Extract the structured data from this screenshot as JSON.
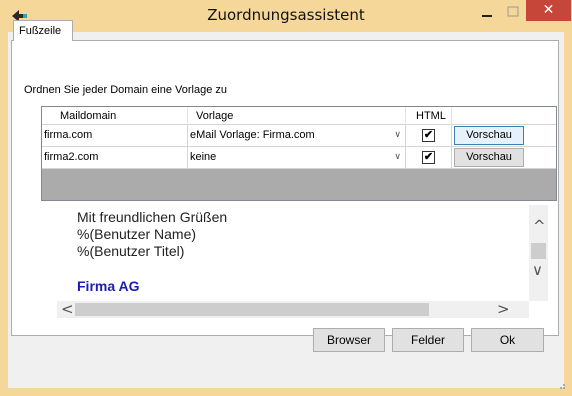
{
  "window": {
    "title": "Zuordnungsassistent",
    "minimize_glyph": "–",
    "close_glyph": "✕",
    "accent_color": "#f6d79a",
    "close_color": "#c7463a"
  },
  "tabs": [
    {
      "label": "Fußzeile"
    }
  ],
  "instruction": "Ordnen Sie jeder Domain eine Vorlage zu",
  "grid": {
    "columns": [
      "Maildomain",
      "Vorlage",
      "HTML"
    ],
    "rows": [
      {
        "domain": "firma.com",
        "template": "eMail Vorlage: Firma.com",
        "html_checked": true,
        "html_glyph": "✔",
        "button": "Vorschau"
      },
      {
        "domain": "firma2.com",
        "template": "keine",
        "html_checked": true,
        "html_glyph": "✔",
        "button": "Vorschau"
      }
    ],
    "dropdown_glyph": "∨"
  },
  "preview": {
    "lines": [
      "Mit freundlichen Grüßen",
      "%(Benutzer Name)",
      "%(Benutzer Titel)"
    ],
    "company": "Firma AG",
    "company_color": "#1b1bb3",
    "scroll_up_glyph": "^",
    "scroll_down_glyph": "∨",
    "scroll_left_glyph": "<",
    "scroll_right_glyph": ">"
  },
  "buttons": {
    "browser": "Browser",
    "fields": "Felder",
    "ok": "Ok"
  }
}
